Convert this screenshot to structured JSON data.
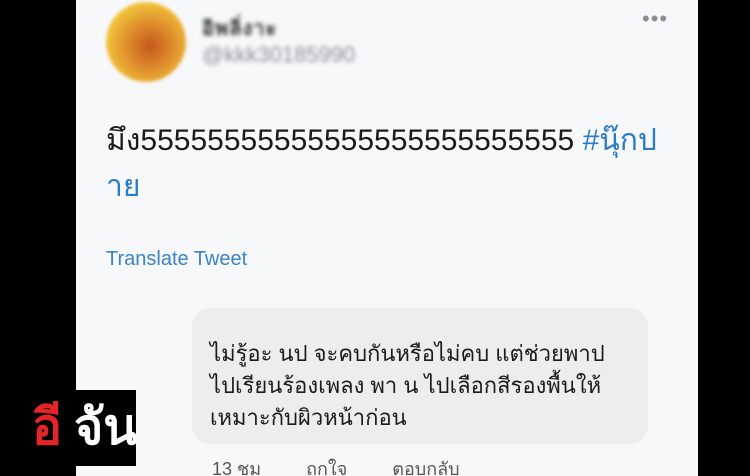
{
  "tweet": {
    "display_name": "อิพลิ่งาะ",
    "handle": "@kkk30185990",
    "text_main": "มึง55555555555555555555555555 ",
    "hashtag": "#นุ๊กปาย",
    "translate_label": "Translate Tweet"
  },
  "reply": {
    "text": "ไม่รู้อะ นป จะคบกันหรือไม่คบ แต่ช่วยพาป ไปเรียนร้องเพลง พา น ไปเลือกสีรองพื้นให้เหมาะกับผิวหน้าก่อน",
    "time": "13 ชม",
    "like_label": "ถูกใจ",
    "reply_label": "ตอบกลับ"
  },
  "logo": {
    "char_1": "อี",
    "char_2": "จัน"
  },
  "colors": {
    "hashtag": "#2a7cc7",
    "link": "#3a83c9",
    "logo_red": "#e52427"
  },
  "icons": {
    "more": "ellipsis-icon"
  }
}
